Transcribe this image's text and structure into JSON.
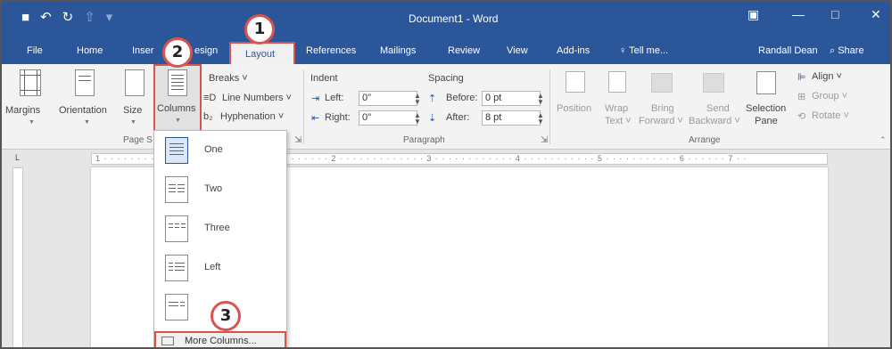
{
  "titlebar": {
    "doc_title": "Document1 - Word",
    "save_icon": "■",
    "undo_icon": "↶",
    "redo_icon": "↻",
    "custom_icon": "⇧",
    "more_icon": "▾",
    "ribbon_display_icon": "▣",
    "minimize_icon": "—",
    "maximize_icon": "□",
    "close_icon": "✕"
  },
  "tabs": {
    "file": "File",
    "home": "Home",
    "insert": "Inser",
    "design": "esign",
    "layout": "Layout",
    "references": "References",
    "mailings": "Mailings",
    "review": "Review",
    "view": "View",
    "addins": "Add-ins",
    "tellme": "♀ Tell me...",
    "user": "Randall Dean",
    "share": "⌕ Share"
  },
  "page_setup": {
    "margins": "Margins",
    "orientation": "Orientation",
    "size": "Size",
    "columns": "Columns",
    "breaks": "Breaks ˅",
    "line_numbers": "Line Numbers ˅",
    "hyphenation": "Hyphenation ˅",
    "group_name": "Page S",
    "line_numbers_prefix": "≡D",
    "hyphenation_prefix": "b₂"
  },
  "paragraph": {
    "indent_label": "Indent",
    "spacing_label": "Spacing",
    "left_label": "Left:",
    "right_label": "Right:",
    "before_label": "Before:",
    "after_label": "After:",
    "left_value": "0\"",
    "right_value": "0\"",
    "before_value": "0 pt",
    "after_value": "8 pt",
    "group_name": "Paragraph",
    "launcher_icon": "⇲"
  },
  "arrange": {
    "position": "Position",
    "wrap_text_1": "Wrap",
    "wrap_text_2": "Text ˅",
    "bring_forward_1": "Bring",
    "bring_forward_2": "Forward ˅",
    "send_backward_1": "Send",
    "send_backward_2": "Backward ˅",
    "selection_pane_1": "Selection",
    "selection_pane_2": "Pane",
    "align": "Align ˅",
    "group": "Group ˅",
    "rotate": "Rotate ˅",
    "group_name": "Arrange"
  },
  "ruler": {
    "text": "1 · · · · · · · · · · · · · · · · · · · · · · · · · · · · · · · · · · 2 · · · · · · · · · · · · · 3 · · · · · · · · · · · · 4 · · · · · · · · · · · 5 · · · · · · · · · · · 6 · · · · · · 7 · ·",
    "tab_selector": "L"
  },
  "dropdown": {
    "items": [
      "One",
      "Two",
      "Three",
      "Left",
      ""
    ],
    "more": "More Columns..."
  },
  "badges": [
    "1",
    "2",
    "3"
  ],
  "colors": {
    "word_blue": "#2b579a",
    "callout_red": "#d9534f"
  }
}
